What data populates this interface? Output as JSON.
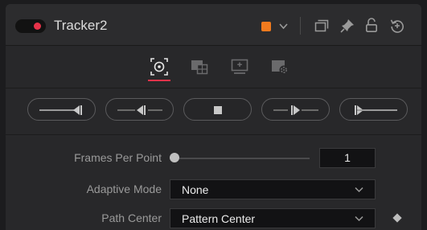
{
  "header": {
    "title": "Tracker2",
    "color_swatch": "#f07a1e",
    "icons": [
      "power-toggle-icon",
      "chevron-down-icon",
      "windows-icon",
      "pin-icon",
      "lock-icon",
      "reset-icon"
    ]
  },
  "tabs": [
    {
      "name": "tab-tracks",
      "icon": "target-icon",
      "active": true
    },
    {
      "name": "tab-operation",
      "icon": "operation-icon",
      "active": false
    },
    {
      "name": "tab-display",
      "icon": "display-icon",
      "active": false
    },
    {
      "name": "tab-settings",
      "icon": "settings-icon",
      "active": false
    }
  ],
  "transport": [
    {
      "name": "track-reverse-from-end",
      "icon": "track-reverse-from-end-icon"
    },
    {
      "name": "track-reverse",
      "icon": "track-reverse-icon"
    },
    {
      "name": "stop-tracking",
      "icon": "stop-icon"
    },
    {
      "name": "track-forward",
      "icon": "track-forward-icon"
    },
    {
      "name": "track-forward-from-start",
      "icon": "track-forward-from-start-icon"
    }
  ],
  "controls": {
    "frames_per_point": {
      "label": "Frames Per Point",
      "value": "1",
      "slider_fraction": 0.0
    },
    "adaptive_mode": {
      "label": "Adaptive Mode",
      "value": "None"
    },
    "path_center": {
      "label": "Path Center",
      "value": "Pattern Center"
    }
  },
  "colors": {
    "accent": "#e8334a",
    "swatch": "#f07a1e",
    "panel": "#28282a"
  }
}
